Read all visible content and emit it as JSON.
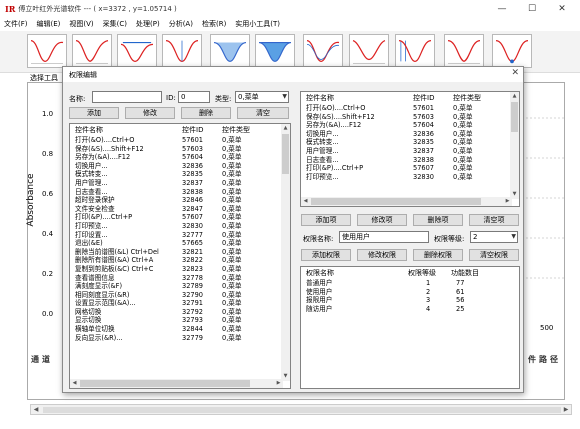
{
  "app": {
    "logo": "IR",
    "title": "傅立叶红外光谱软件 --- ( x=3372 , y=1.05714 )",
    "menu": [
      "文件(F)",
      "编辑(E)",
      "视图(V)",
      "采集(C)",
      "处理(P)",
      "分析(A)",
      "检索(R)",
      "实用小工具(T)"
    ],
    "mode_label": "选择工具",
    "y_axis_title": "Absorbance",
    "y_ticks": [
      "1.0",
      "0.8",
      "0.6",
      "0.4",
      "0.2",
      "0.0"
    ],
    "x_tick_right": "500",
    "bottom_left_text": "通道",
    "bottom_right_text": "件路径"
  },
  "dialog": {
    "title": "权限编辑",
    "left": {
      "name_label": "名称:",
      "name_value": "",
      "id_label": "ID:",
      "id_value": "0",
      "type_label": "类型:",
      "type_value": "0,菜单",
      "buttons": [
        "添加",
        "修改",
        "删除",
        "清空"
      ],
      "columns": [
        "控件名称",
        "控件ID",
        "控件类型"
      ],
      "rows": [
        [
          "打开(&O)....Ctrl+O",
          "57601",
          "0,菜单"
        ],
        [
          "保存(&S)....Shift+F12",
          "57603",
          "0,菜单"
        ],
        [
          "另存为(&A)....F12",
          "57604",
          "0,菜单"
        ],
        [
          "切换用户...",
          "32836",
          "0,菜单"
        ],
        [
          "模式转变...",
          "32835",
          "0,菜单"
        ],
        [
          "用户管理...",
          "32837",
          "0,菜单"
        ],
        [
          "日志查看...",
          "32838",
          "0,菜单"
        ],
        [
          "超时登录保护",
          "32846",
          "0,菜单"
        ],
        [
          "文件安全检查",
          "32847",
          "0,菜单"
        ],
        [
          "打印(&P)....Ctrl+P",
          "57607",
          "0,菜单"
        ],
        [
          "打印预览...",
          "32830",
          "0,菜单"
        ],
        [
          "打印设置...",
          "32777",
          "0,菜单"
        ],
        [
          "退出(&E)",
          "57665",
          "0,菜单"
        ],
        [
          "删除当前谱图(&L) Ctrl+Del",
          "32821",
          "0,菜单"
        ],
        [
          "删除所有谱图(&A) Ctrl+A",
          "32822",
          "0,菜单"
        ],
        [
          "复制到剪贴板(&C) Ctrl+C",
          "32823",
          "0,菜单"
        ],
        [
          "查看谱图信息",
          "32778",
          "0,菜单"
        ],
        [
          "满刻度显示(&F)",
          "32789",
          "0,菜单"
        ],
        [
          "相同刻度显示(&R)",
          "32790",
          "0,菜单"
        ],
        [
          "设置显示范围(&A)...",
          "32791",
          "0,菜单"
        ],
        [
          "网格切换",
          "32792",
          "0,菜单"
        ],
        [
          "显示切换",
          "32793",
          "0,菜单"
        ],
        [
          "横轴单位切换",
          "32844",
          "0,菜单"
        ],
        [
          "反向显示(&R)...",
          "32779",
          "0,菜单"
        ]
      ]
    },
    "right_top": {
      "columns": [
        "控件名称",
        "控件ID",
        "控件类型"
      ],
      "rows": [
        [
          "打开(&O)....Ctrl+O",
          "57601",
          "0,菜单"
        ],
        [
          "保存(&S)....Shift+F12",
          "57603",
          "0,菜单"
        ],
        [
          "另存为(&A)....F12",
          "57604",
          "0,菜单"
        ],
        [
          "切换用户...",
          "32836",
          "0,菜单"
        ],
        [
          "模式转变...",
          "32835",
          "0,菜单"
        ],
        [
          "用户管理...",
          "32837",
          "0,菜单"
        ],
        [
          "日志查看...",
          "32838",
          "0,菜单"
        ],
        [
          "打印(&P)....Ctrl+P",
          "57607",
          "0,菜单"
        ],
        [
          "打印预览...",
          "32830",
          "0,菜单"
        ]
      ],
      "buttons": [
        "添加项",
        "修改项",
        "删除项",
        "清空项"
      ]
    },
    "permission": {
      "name_label": "权限名称:",
      "name_value": "使用用户",
      "level_label": "权限等级:",
      "level_value": "2",
      "buttons": [
        "添加权限",
        "修改权限",
        "删除权限",
        "清空权限"
      ],
      "columns": [
        "权限名称",
        "权限等级",
        "功能数目"
      ],
      "rows": [
        [
          "普通用户",
          "1",
          "77"
        ],
        [
          "使用用户",
          "2",
          "61"
        ],
        [
          "报限用户",
          "3",
          "56"
        ],
        [
          "随访用户",
          "4",
          "25"
        ]
      ]
    }
  }
}
